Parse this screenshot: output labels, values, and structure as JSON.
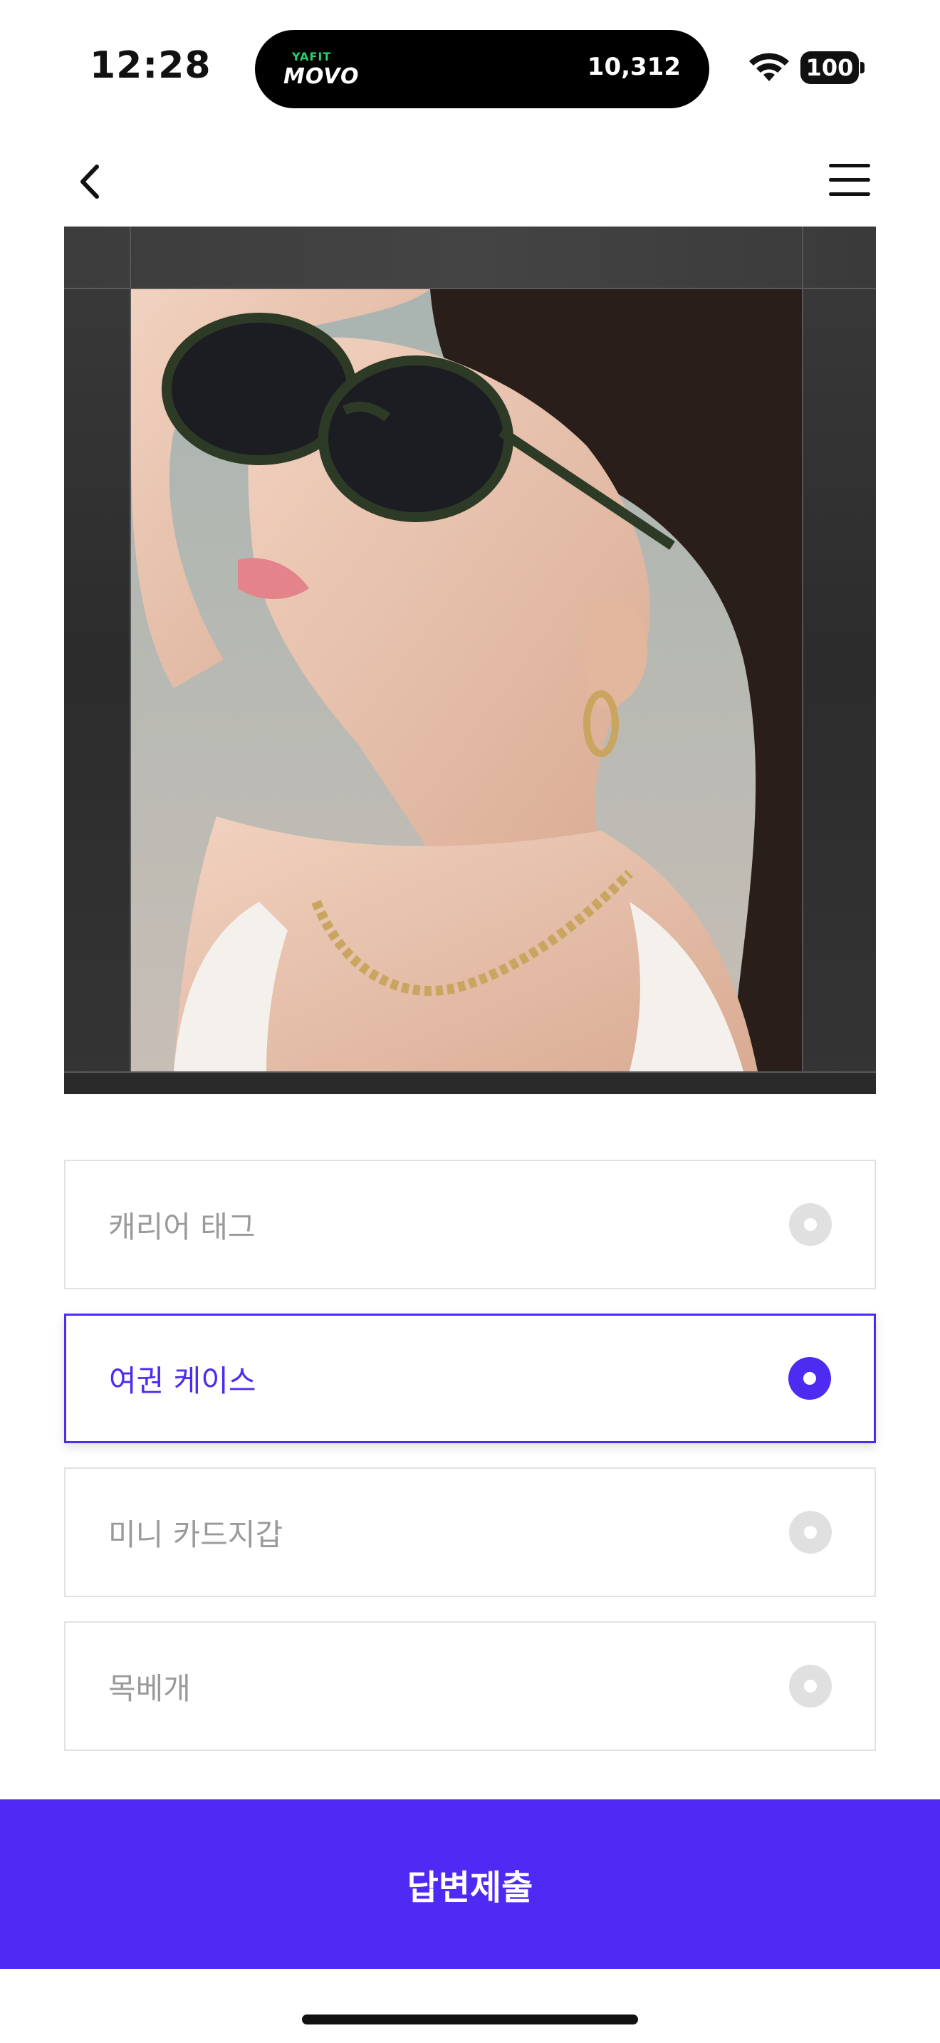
{
  "status_bar": {
    "time": "12:28",
    "island_brand_top": "YAFIT",
    "island_brand": "MOVO",
    "steps": "10,312",
    "battery": "100",
    "wifi_icon": "wifi-icon"
  },
  "nav": {
    "back_icon": "chevron-left-icon",
    "menu_icon": "hamburger-menu-icon"
  },
  "options": [
    {
      "label": "캐리어 태그",
      "selected": false
    },
    {
      "label": "여권 케이스",
      "selected": true
    },
    {
      "label": "미니 카드지갑",
      "selected": false
    },
    {
      "label": "목베개",
      "selected": false
    }
  ],
  "submit": {
    "label": "답변제출"
  },
  "colors": {
    "accent": "#4f2af5",
    "unselected": "#9a9a9a",
    "radio_off": "#e0e0e0"
  }
}
